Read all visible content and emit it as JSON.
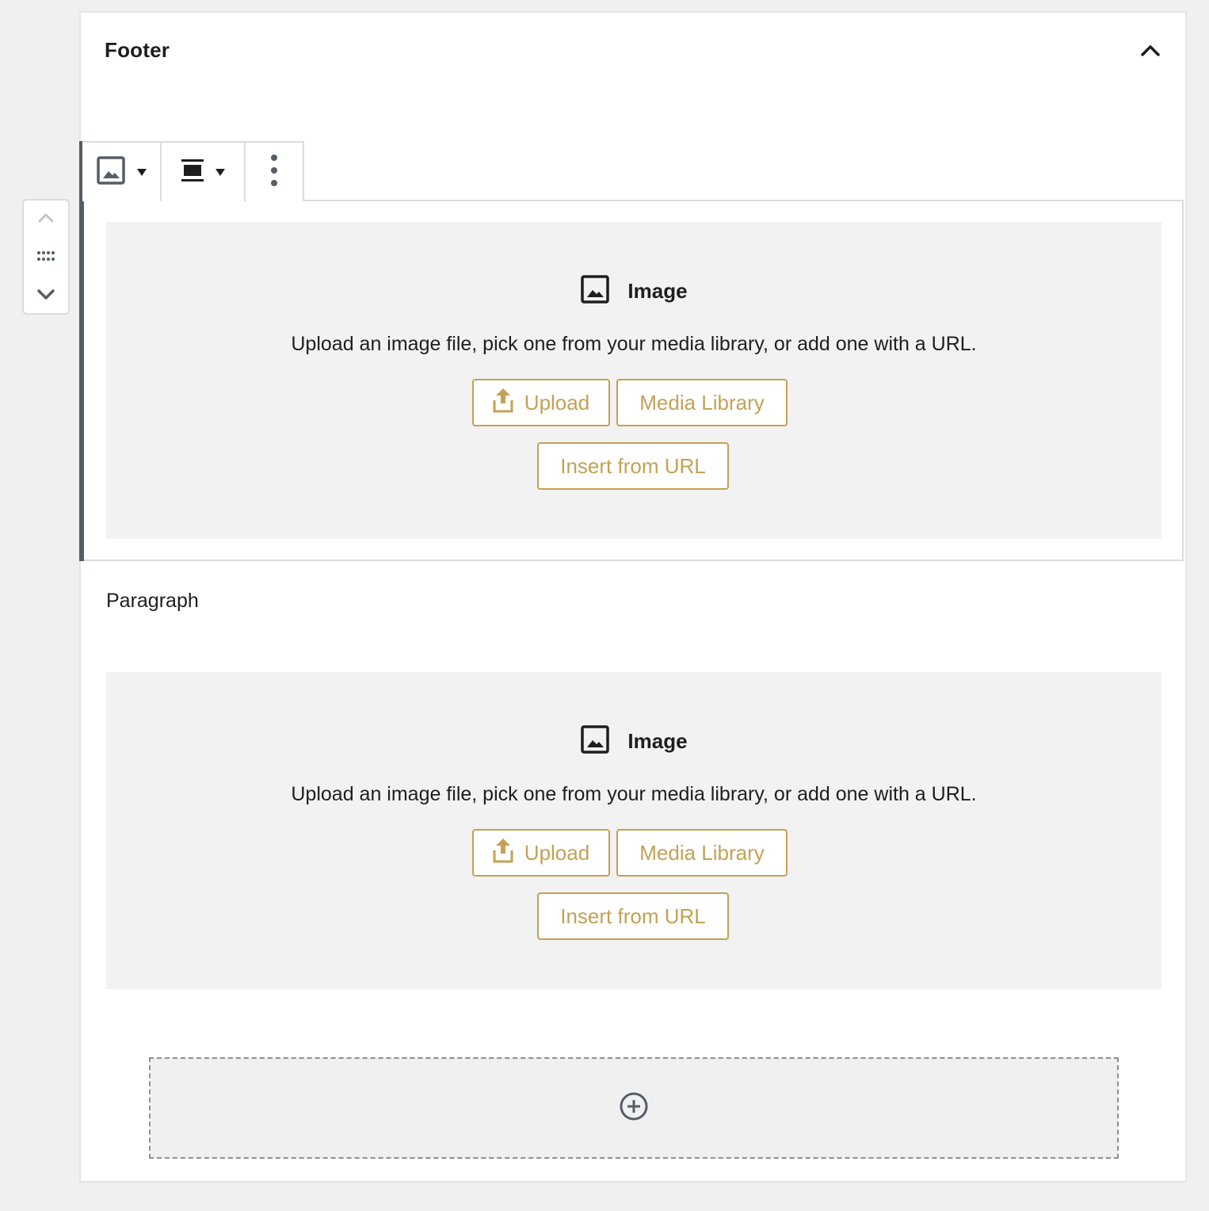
{
  "panel": {
    "title": "Footer",
    "collapse_icon": "chevron-up-icon"
  },
  "mover": {
    "up_icon": "chevron-up-icon",
    "drag_icon": "drag-handle-icon",
    "down_icon": "chevron-down-icon"
  },
  "toolbar": {
    "block_type_icon": "image-icon",
    "align_icon": "align-center-icon",
    "more_icon": "more-vertical-icon"
  },
  "image_blocks": [
    {
      "label": "Image",
      "instructions": "Upload an image file, pick one from your media library, or add one with a URL.",
      "upload_label": "Upload",
      "media_label": "Media Library",
      "url_label": "Insert from URL"
    },
    {
      "label": "Image",
      "instructions": "Upload an image file, pick one from your media library, or add one with a URL.",
      "upload_label": "Upload",
      "media_label": "Media Library",
      "url_label": "Insert from URL"
    }
  ],
  "paragraph": {
    "placeholder": "Paragraph"
  },
  "appender": {
    "icon": "plus-circle-icon"
  },
  "colors": {
    "accent": "#c4a155",
    "border": "#dcdcde",
    "placeholder_bg": "#f2f2f2",
    "selected_bar": "#555d66"
  }
}
